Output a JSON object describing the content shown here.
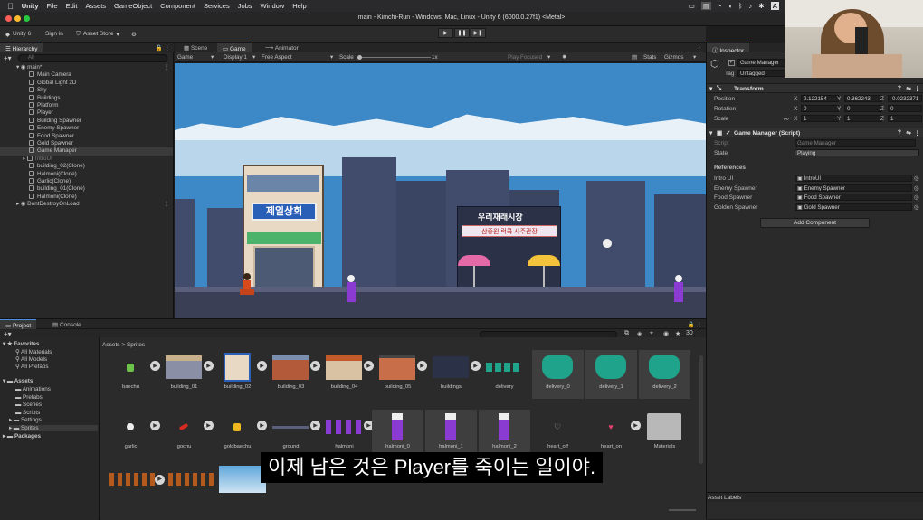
{
  "menubar": {
    "apple_icon": "apple-icon",
    "items": [
      "Unity",
      "File",
      "Edit",
      "Assets",
      "GameObject",
      "Component",
      "Services",
      "Jobs",
      "Window",
      "Help"
    ],
    "right_icons": [
      "screen-mirroring-icon",
      "control-center-icon",
      "wifi-icon",
      "volume-icon",
      "bluetooth-icon",
      "siri-icon",
      "keyboard-input-icon"
    ],
    "input_source": "A"
  },
  "window": {
    "title": "main - Kimchi-Run - Windows, Mac, Linux - Unity 6 (6000.0.27f1) <Metal>"
  },
  "toolbar": {
    "account": "Unity 6",
    "sign_in": "Sign in",
    "asset_store": "Asset Store",
    "play_icons": [
      "play-icon",
      "pause-icon",
      "step-icon"
    ]
  },
  "hierarchy": {
    "tab": "Hierarchy",
    "search_placeholder": "All",
    "scene_name": "main*",
    "items": [
      {
        "label": "Main Camera",
        "state": "normal"
      },
      {
        "label": "Global Light 2D",
        "state": "normal"
      },
      {
        "label": "Sky",
        "state": "normal"
      },
      {
        "label": "Buildings",
        "state": "normal"
      },
      {
        "label": "Platform",
        "state": "normal"
      },
      {
        "label": "Player",
        "state": "normal"
      },
      {
        "label": "Building Spawner",
        "state": "normal"
      },
      {
        "label": "Enemy Spawner",
        "state": "normal"
      },
      {
        "label": "Food Spawner",
        "state": "normal"
      },
      {
        "label": "Gold Spawner",
        "state": "normal"
      },
      {
        "label": "Game Manager",
        "state": "selected"
      },
      {
        "label": "IntroUI",
        "state": "dim"
      },
      {
        "label": "building_02(Clone)",
        "state": "normal"
      },
      {
        "label": "Halmoni(Clone)",
        "state": "normal"
      },
      {
        "label": "Garlic(Clone)",
        "state": "normal"
      },
      {
        "label": "building_01(Clone)",
        "state": "normal"
      },
      {
        "label": "Halmoni(Clone)",
        "state": "normal"
      }
    ],
    "dont_destroy": "DontDestroyOnLoad"
  },
  "center_tabs": [
    "Scene",
    "Game",
    "Animator"
  ],
  "game_bar": {
    "mode": "Game",
    "display": "Display 1",
    "aspect": "Free Aspect",
    "scale_label": "Scale",
    "scale_value": "1x",
    "play_focused": "Play Focused",
    "stats": "Stats",
    "gizmos": "Gizmos"
  },
  "game_scene": {
    "sign_left": "제일상회",
    "sign_market": "우리재래시장",
    "sign_shop": "삼좋원 럭쿡 사주관장"
  },
  "inspector": {
    "tab": "Inspector",
    "object_name": "Game Manager",
    "tag_label": "Tag",
    "tag_value": "Untagged",
    "transform": {
      "title": "Transform",
      "position_label": "Position",
      "rotation_label": "Rotation",
      "scale_label": "Scale",
      "position": {
        "x": "2.122154",
        "y": "0.362243",
        "z": "-0.0232371"
      },
      "rotation": {
        "x": "0",
        "y": "0",
        "z": "0"
      },
      "scale": {
        "x": "1",
        "y": "1",
        "z": "1"
      }
    },
    "script_component": {
      "title": "Game Manager (Script)",
      "script_label": "Script",
      "script_value": "Game Manager",
      "state_label": "State",
      "state_value": "Playing",
      "references_header": "References",
      "refs": [
        {
          "label": "Intro UI",
          "value": "IntroUI"
        },
        {
          "label": "Enemy Spawner",
          "value": "Enemy Spawner"
        },
        {
          "label": "Food Spawner",
          "value": "Food Spawner"
        },
        {
          "label": "Golden Spawner",
          "value": "Gold Spawner"
        }
      ]
    },
    "add_component": "Add Component",
    "asset_labels": "Asset Labels"
  },
  "project": {
    "tabs": [
      "Project",
      "Console"
    ],
    "favorites_header": "Favorites",
    "favorites": [
      "All Materials",
      "All Models",
      "All Prefabs"
    ],
    "assets_header": "Assets",
    "folders": [
      "Animations",
      "Prefabs",
      "Scenes",
      "Scripts",
      "Settings",
      "Sprites"
    ],
    "packages": "Packages",
    "breadcrumb": [
      "Assets",
      "Sprites"
    ],
    "icon_size": "30",
    "row1": [
      "baechu",
      "building_01",
      "building_02",
      "building_03",
      "building_04",
      "building_05",
      "buildings",
      "delivery",
      "delivery_0",
      "delivery_1",
      "delivery_2"
    ],
    "row2": [
      "garlic",
      "gochu",
      "goldbaechu",
      "ground",
      "halmoni",
      "halmoni_0",
      "halmoni_1",
      "halmoni_2",
      "heart_off",
      "heart_on",
      "Materials"
    ]
  },
  "subtitle": "이제 남은 것은 Player를 죽이는 일이야."
}
